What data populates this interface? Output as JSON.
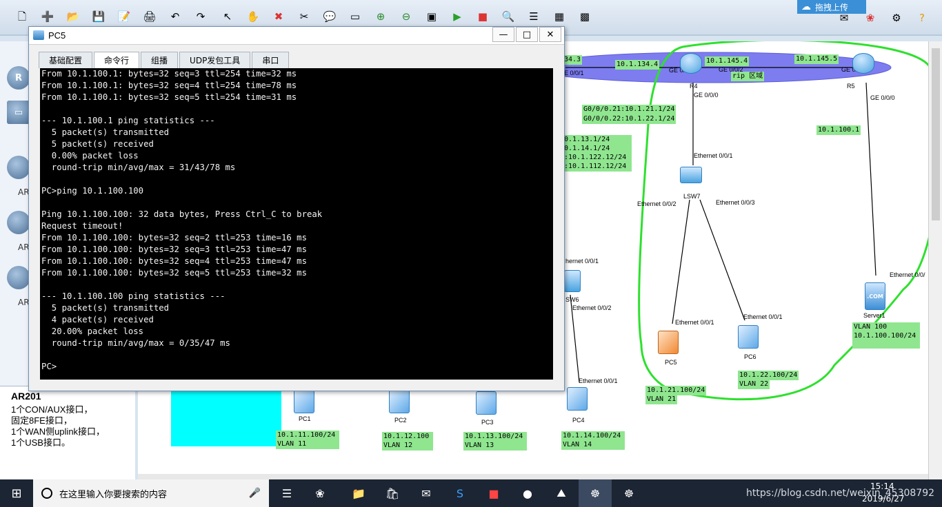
{
  "toolbar": {
    "icons": [
      "new-topology-icon",
      "new-device-icon",
      "open-icon",
      "save-icon",
      "save-as-icon",
      "print-icon",
      "undo-icon",
      "redo-icon",
      "select-icon",
      "pan-hand-icon",
      "delete-icon",
      "delete-link-icon",
      "text-note-icon",
      "palette-icon",
      "zoom-in-icon",
      "zoom-out-icon",
      "fit-icon",
      "start-icon",
      "stop-icon",
      "capture-icon",
      "topology-icon",
      "grid-icon",
      "screenshot-icon"
    ],
    "upload_label": "拖拽上传"
  },
  "palette": {
    "device_labels": [
      "AR",
      "AR",
      "AR"
    ],
    "selected_title": "AR201",
    "desc_lines": [
      "1个CON/AUX接口，",
      "固定8FE接口，",
      "1个WAN侧uplink接口，",
      "1个USB接口。"
    ]
  },
  "pc5": {
    "title": "PC5",
    "tabs": [
      "基础配置",
      "命令行",
      "组播",
      "UDP发包工具",
      "串口"
    ],
    "active_tab": "命令行",
    "console_lines": [
      "From 10.1.100.1: bytes=32 seq=3 ttl=254 time=32 ms",
      "From 10.1.100.1: bytes=32 seq=4 ttl=254 time=78 ms",
      "From 10.1.100.1: bytes=32 seq=5 ttl=254 time=31 ms",
      "",
      "--- 10.1.100.1 ping statistics ---",
      "  5 packet(s) transmitted",
      "  5 packet(s) received",
      "  0.00% packet loss",
      "  round-trip min/avg/max = 31/43/78 ms",
      "",
      "PC>ping 10.1.100.100",
      "",
      "Ping 10.1.100.100: 32 data bytes, Press Ctrl_C to break",
      "Request timeout!",
      "From 10.1.100.100: bytes=32 seq=2 ttl=253 time=16 ms",
      "From 10.1.100.100: bytes=32 seq=3 ttl=253 time=47 ms",
      "From 10.1.100.100: bytes=32 seq=4 ttl=253 time=47 ms",
      "From 10.1.100.100: bytes=32 seq=5 ttl=253 time=32 ms",
      "",
      "--- 10.1.100.100 ping statistics ---",
      "  5 packet(s) transmitted",
      "  4 packet(s) received",
      "  20.00% packet loss",
      "  round-trip min/avg/max = 0/35/47 ms",
      "",
      "PC>"
    ]
  },
  "topology": {
    "labels": {
      "l_134_3": "34.3",
      "l_134_4": "10.1.134.4",
      "l_145_4": "10.1.145.4",
      "l_145_5": "10.1.145.5",
      "rip": "rip 区域",
      "g0_21": "G0/0/0.21:10.1.21.1/24",
      "g0_22": "G0/0/0.22:10.1.22.1/24",
      "sub_a": "0.1.13.1/24",
      "sub_b": "0.1.14.1/24",
      "sub_c": ":10.1.122.12/24",
      "sub_d": ":10.1.112.12/24",
      "l_100_1": "10.1.100.1",
      "server_vlan": "VLAN 100",
      "server_ip": "10.1.100.100/24",
      "pc5_ip": "10.1.21.100/24",
      "pc5_vlan": "VLAN 21",
      "pc6_ip": "10.1.22.100/24",
      "pc6_vlan": "VLAN 22",
      "pc1_ip": "10.1.11.100/24",
      "pc1_vlan": "VLAN 11",
      "pc2_ip": "10.1.12.100",
      "pc2_vlan": "VLAN 12",
      "pc3_ip": "10.1.13.100/24",
      "pc3_vlan": "VLAN 13",
      "pc4_ip": "10.1.14.100/24",
      "pc4_vlan": "VLAN 14"
    },
    "ports": {
      "ge001_r3": "E 0/0/1",
      "r4_ge001": "GE 0/0/1",
      "r4_ge002": "GE 0/0/2",
      "r5_ge001": "GE 0/0/1",
      "r4_ge000": "GE 0/0/0",
      "r5_ge000": "GE 0/0/0",
      "lsw_e001": "Ethernet 0/0/1",
      "lsw_e002": "Ethernet 0/0/2",
      "lsw_e003": "Ethernet 0/0/3",
      "pc5_e001": "Ethernet 0/0/1",
      "pc6_e001": "Ethernet 0/0/1",
      "server_e": "Ethernet 0/0/",
      "sw6_e001": "hernet 0/0/1",
      "sw6_e002": "Ethernet 0/0/2",
      "pc4_e001": "Ethernet 0/0/1"
    },
    "devices": {
      "r4": "R4",
      "r5": "R5",
      "lsw": "LSW7",
      "pc5": "PC5",
      "pc6": "PC6",
      "server": "Server1",
      "server_badge": ".COM",
      "sw6": "SW6",
      "pc1": "PC1",
      "pc2": "PC2",
      "pc3": "PC3",
      "pc4": "PC4"
    }
  },
  "taskbar": {
    "search_placeholder": "在这里输入你要搜索的内容",
    "time": "15:14",
    "date": "2019/6/27",
    "tray_text": "https://blog.csdn.net/weixin_45308792"
  }
}
